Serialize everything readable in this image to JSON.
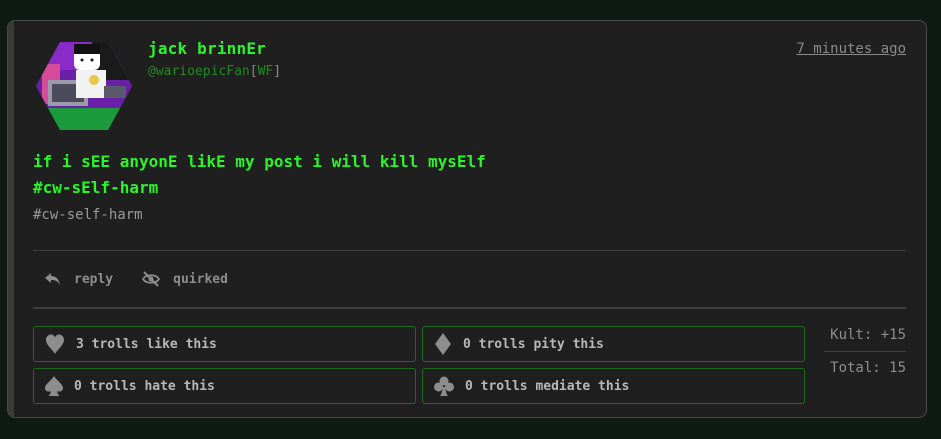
{
  "post": {
    "display_name": "jack brinnEr",
    "handle": "@warioepicFan",
    "initials": "WF",
    "timestamp": "7 minutes ago",
    "body_line1": "if i sEE anyonE likE my post i will kill mysElf",
    "body_line2": "#cw-sElf-harm",
    "hashtag": "#cw-self-harm"
  },
  "actions": {
    "reply_label": "reply",
    "quirked_label": "quirked"
  },
  "reactions": [
    {
      "label": "3 trolls like this",
      "icon": "heart-icon"
    },
    {
      "label": "0 trolls pity this",
      "icon": "diamond-icon"
    },
    {
      "label": "0 trolls hate this",
      "icon": "spade-icon"
    },
    {
      "label": "0 trolls mediate this",
      "icon": "club-icon"
    }
  ],
  "totals": {
    "kult": "Kult: +15",
    "total": "Total: 15"
  },
  "colors": {
    "accent_green": "#2af52a",
    "handle_green": "#1f8a1f",
    "border_green": "#1e6b1e",
    "card_bg": "#1f1f1f",
    "page_bg": "#0e1a14"
  }
}
